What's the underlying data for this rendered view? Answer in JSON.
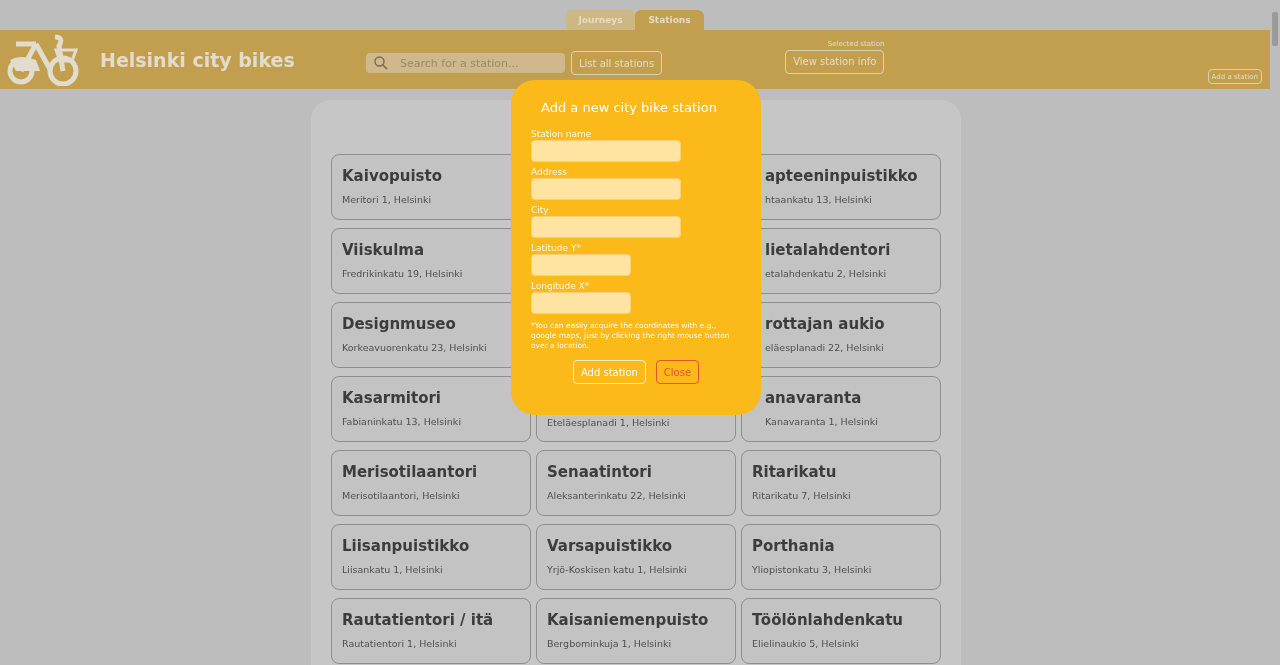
{
  "tabs": [
    {
      "label": "Journeys",
      "selected": false
    },
    {
      "label": "Stations",
      "selected": true
    }
  ],
  "header": {
    "title": "Helsinki city bikes",
    "search": {
      "placeholder": "Search for a station..."
    },
    "list_button": "List all stations",
    "selected_label": "Selected station",
    "view_button": "View station info",
    "add_button": "Add a station"
  },
  "rows": [
    [
      {
        "name": "Kaivopuisto",
        "address": "Meritori 1, Helsinki"
      },
      {},
      {
        "name": "apteeninpuistikko",
        "address": "htaankatu 13, Helsinki",
        "partly_hidden": true
      }
    ],
    [
      {
        "name": "Viiskulma",
        "address": "Fredrikinkatu 19, Helsinki"
      },
      {},
      {
        "name": "lietalahdentori",
        "address": "etalahdenkatu 2, Helsinki",
        "partly_hidden": true
      }
    ],
    [
      {
        "name": "Designmuseo",
        "address": "Korkeavuorenkatu 23, Helsinki"
      },
      {},
      {
        "name": "rottajan aukio",
        "address": "eläesplanadi 22, Helsinki",
        "partly_hidden": true
      }
    ],
    [
      {
        "name": "Kasarmitori",
        "address": "Fabianinkatu 13, Helsinki"
      },
      {
        "address": "Eteläesplanadi 1, Helsinki"
      },
      {
        "name": "anavaranta",
        "address": "Kanavaranta 1, Helsinki",
        "partly_hidden": true
      }
    ],
    [
      {
        "name": "Merisotilaantori",
        "address": "Merisotilaantori, Helsinki"
      },
      {
        "name": "Senaatintori",
        "address": "Aleksanterinkatu 22, Helsinki"
      },
      {
        "name": "Ritarikatu",
        "address": "Ritarikatu 7, Helsinki"
      }
    ],
    [
      {
        "name": "Liisanpuistikko",
        "address": "Liisankatu 1, Helsinki"
      },
      {
        "name": "Varsapuistikko",
        "address": "Yrjö-Koskisen katu 1, Helsinki"
      },
      {
        "name": "Porthania",
        "address": "Yliopistonkatu 3, Helsinki"
      }
    ],
    [
      {
        "name": "Rautatientori / itä",
        "address": "Rautatientori 1, Helsinki"
      },
      {
        "name": "Kaisaniemenpuisto",
        "address": "Bergbominkuja 1, Helsinki"
      },
      {
        "name": "Töölönlahdenkatu",
        "address": "Elielinaukio 5, Helsinki"
      }
    ]
  ],
  "modal": {
    "title": "Add a new city bike station",
    "fields": [
      {
        "label": "Station name",
        "kind": "wide"
      },
      {
        "label": "Address",
        "kind": "wide"
      },
      {
        "label": "City",
        "kind": "wide"
      },
      {
        "label": "Latitude Y*",
        "kind": "narrow"
      },
      {
        "label": "Longitude X*",
        "kind": "narrow"
      }
    ],
    "note": "*You can easily acquire the coordinates with e.g., google maps, just by clicking the right mouse button over a location.",
    "buttons": [
      {
        "label": "Add station",
        "kind": "primary"
      },
      {
        "label": "Close",
        "kind": "danger"
      }
    ]
  }
}
